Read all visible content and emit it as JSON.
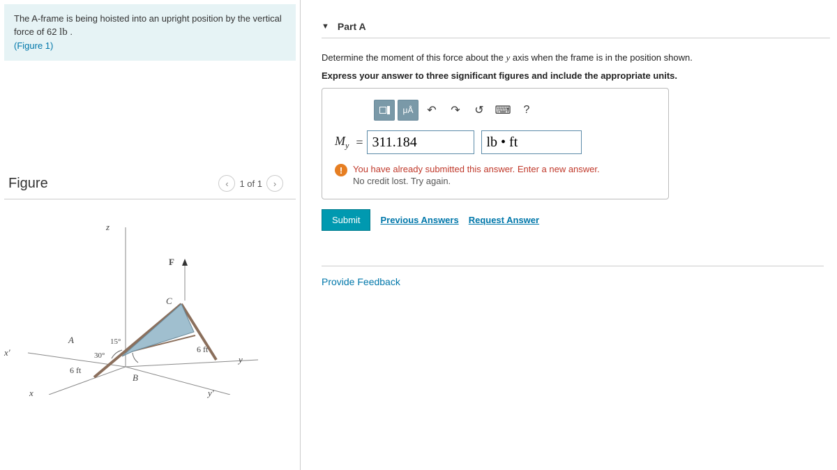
{
  "intro": {
    "text1": "The A-frame is being hoisted into an upright position by the vertical force of 62 ",
    "unit": "lb",
    "text2": " .",
    "figlink": "(Figure 1)"
  },
  "figure": {
    "title": "Figure",
    "pager": "1 of 1",
    "labels": {
      "z": "z",
      "F": "F",
      "C": "C",
      "A": "A",
      "B": "B",
      "ang15": "15°",
      "ang30": "30°",
      "d1": "6 ft",
      "d2": "6 ft",
      "x": "x",
      "xp": "x'",
      "y": "y",
      "yp": "y'"
    }
  },
  "part": {
    "label": "Part A",
    "instr1a": "Determine the moment of this force about the ",
    "instr1b": "y",
    "instr1c": " axis when the frame is in the position shown.",
    "instr2": "Express your answer to three significant figures and include the appropriate units."
  },
  "toolbar": {
    "templates": "□",
    "greek": "μÅ",
    "undo": "↶",
    "redo": "↷",
    "reset": "↺",
    "keyboard": "⌨",
    "help": "?"
  },
  "answer": {
    "varprefix": "M",
    "varsub": "y",
    "eq": "=",
    "value": "311.184",
    "units": "lb • ft"
  },
  "feedback": {
    "icon": "!",
    "line1": "You have already submitted this answer. Enter a new answer.",
    "line2": "No credit lost. Try again."
  },
  "actions": {
    "submit": "Submit",
    "prev": "Previous Answers",
    "request": "Request Answer"
  },
  "footer": {
    "provide": "Provide Feedback"
  }
}
